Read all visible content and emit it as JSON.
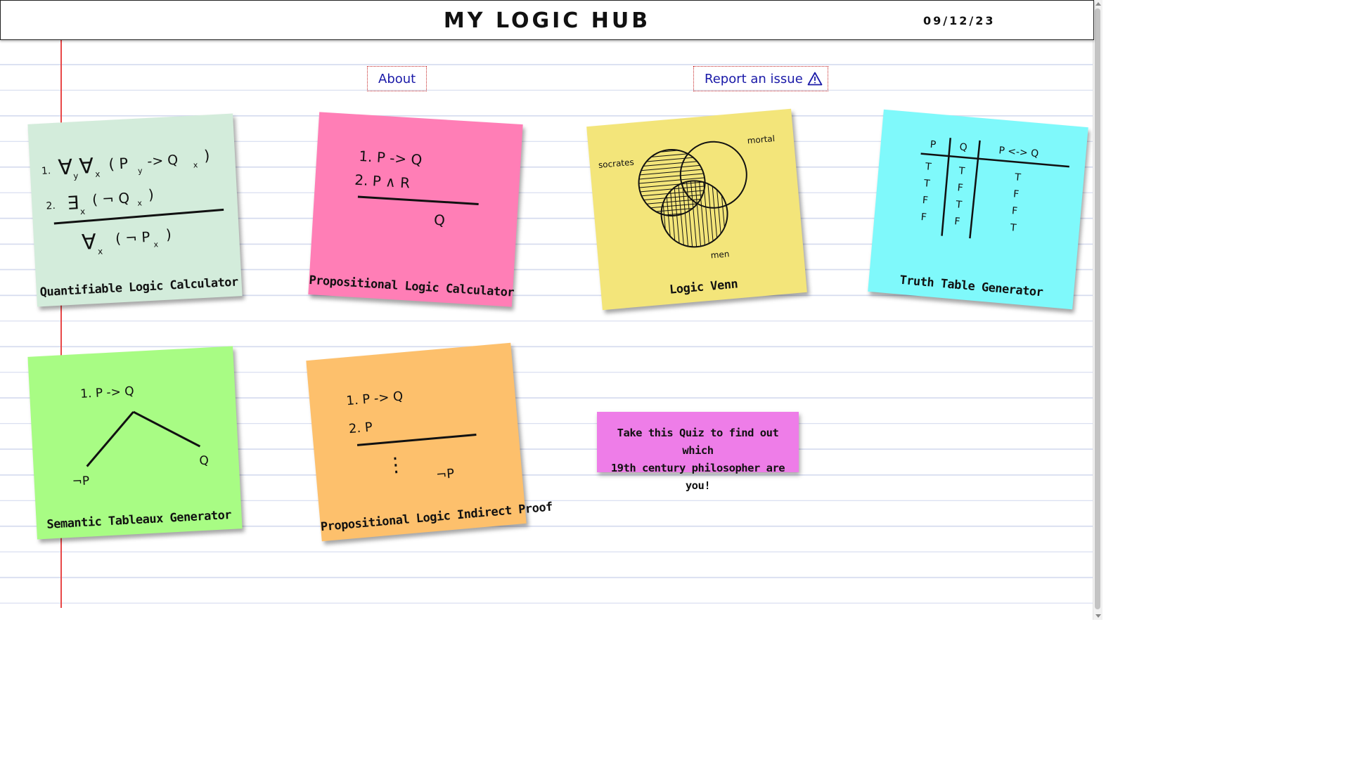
{
  "header": {
    "title": "MY LOGIC HUB",
    "date": "09/12/23"
  },
  "nav": {
    "about": "About",
    "report": "Report an issue",
    "report_icon": "warning-triangle-icon"
  },
  "notes": [
    {
      "label": "Quantifiable Logic Calculator",
      "color": "#d3ecdb",
      "lines": [
        "1.",
        "∀",
        "y",
        "∀",
        "x",
        "( P",
        "y",
        "-> Q",
        "x",
        ")",
        "2.",
        "∃",
        "x",
        "( ¬ Q",
        "x",
        ")",
        "∀",
        "x",
        "( ¬ P",
        "x",
        ")"
      ]
    },
    {
      "label": "Propositional Logic Calculator",
      "color": "#ff7eb6",
      "lines": [
        "1. P -> Q",
        "2. P ∧ R",
        "Q"
      ]
    },
    {
      "label": "Logic Venn",
      "color": "#f3e57a",
      "lines": [
        "socrates",
        "mortal",
        "men"
      ]
    },
    {
      "label": "Truth Table Generator",
      "color": "#7ff9fb",
      "lines": [
        "P",
        "Q",
        "P <-> Q",
        "T",
        "T",
        "F",
        "F",
        "T",
        "F",
        "T",
        "F",
        "T",
        "F",
        "F",
        "T"
      ]
    },
    {
      "label": "Semantic Tableaux Generator",
      "color": "#a8fc84",
      "lines": [
        "1. P -> Q",
        "¬P",
        "Q"
      ]
    },
    {
      "label": "Propositional Logic Indirect Proof",
      "color": "#fdc06c",
      "lines": [
        "1. P -> Q",
        "2. P",
        "⋮",
        "¬P"
      ]
    }
  ],
  "quiz": {
    "line1": "Take this Quiz to find out which",
    "line2": "19th century philosopher are you!",
    "color": "#ee7de8"
  }
}
